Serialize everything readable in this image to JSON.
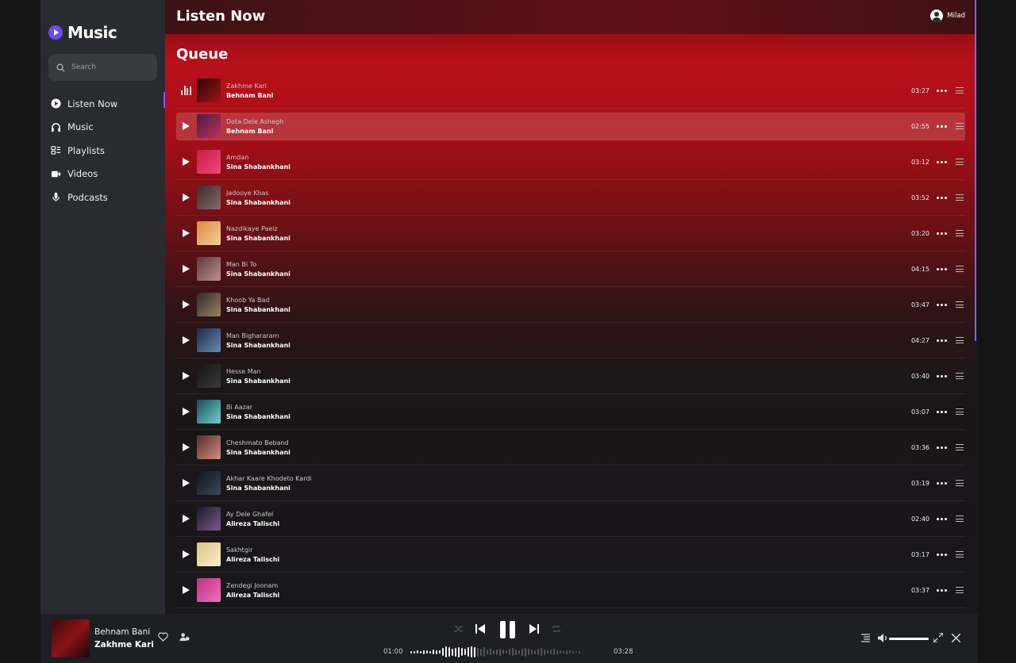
{
  "app": {
    "name": "Music"
  },
  "search": {
    "placeholder": "Search"
  },
  "sidebar": {
    "items": [
      {
        "label": "Listen Now",
        "icon": "play-circle-icon",
        "active": true
      },
      {
        "label": "Music",
        "icon": "headphones-icon",
        "active": false
      },
      {
        "label": "Playlists",
        "icon": "playlist-icon",
        "active": false
      },
      {
        "label": "Videos",
        "icon": "video-icon",
        "active": false
      },
      {
        "label": "Podcasts",
        "icon": "microphone-icon",
        "active": false
      }
    ]
  },
  "header": {
    "title": "Listen Now",
    "user": "Milad"
  },
  "queue": {
    "title": "Queue",
    "tracks": [
      {
        "title": "Zakhme Kari",
        "artist": "Behnam Bani",
        "duration": "03:27",
        "state": "playing",
        "art": [
          "#2a0607",
          "#a11418"
        ]
      },
      {
        "title": "Dota Dele Ashegh",
        "artist": "Behnam Bani",
        "duration": "02:55",
        "state": "hover",
        "art": [
          "#4a1a4a",
          "#c0305a"
        ]
      },
      {
        "title": "Amdan",
        "artist": "Sina Shabankhani",
        "duration": "03:12",
        "state": "",
        "art": [
          "#c81a4a",
          "#f04a78"
        ]
      },
      {
        "title": "Jadooye Khas",
        "artist": "Sina Shabankhani",
        "duration": "03:52",
        "state": "",
        "art": [
          "#3a2a2a",
          "#8a6a6a"
        ]
      },
      {
        "title": "Nazdikaye Paeiz",
        "artist": "Sina Shabankhani",
        "duration": "03:20",
        "state": "",
        "art": [
          "#e08a3a",
          "#f0d0a0"
        ]
      },
      {
        "title": "Man Bi To",
        "artist": "Sina Shabankhani",
        "duration": "04:15",
        "state": "",
        "art": [
          "#5a3a3a",
          "#c09090"
        ]
      },
      {
        "title": "Khoob Ya Bad",
        "artist": "Sina Shabankhani",
        "duration": "03:47",
        "state": "",
        "art": [
          "#2a2a2a",
          "#a08060"
        ]
      },
      {
        "title": "Man Bighararam",
        "artist": "Sina Shabankhani",
        "duration": "04:27",
        "state": "",
        "art": [
          "#1a2a4a",
          "#6a8ab0"
        ]
      },
      {
        "title": "Hesse Man",
        "artist": "Sina Shabankhani",
        "duration": "03:40",
        "state": "",
        "art": [
          "#141414",
          "#3a3a3a"
        ]
      },
      {
        "title": "Bi Aazar",
        "artist": "Sina Shabankhani",
        "duration": "03:07",
        "state": "",
        "art": [
          "#1a4a5a",
          "#70d0d0"
        ]
      },
      {
        "title": "Cheshmato Beband",
        "artist": "Sina Shabankhani",
        "duration": "03:36",
        "state": "",
        "art": [
          "#5a2a2a",
          "#d09080"
        ]
      },
      {
        "title": "Akhar Kaare Khodeto Kardi",
        "artist": "Sina Shabankhani",
        "duration": "03:19",
        "state": "",
        "art": [
          "#101418",
          "#3a4a5a"
        ]
      },
      {
        "title": "Ay Dele Ghafel",
        "artist": "Alireza Talischi",
        "duration": "02:40",
        "state": "",
        "art": [
          "#1a1a2a",
          "#7a5a8a"
        ]
      },
      {
        "title": "Sakhtgir",
        "artist": "Alireza Talischi",
        "duration": "03:17",
        "state": "",
        "art": [
          "#e0c080",
          "#f8f0d0"
        ]
      },
      {
        "title": "Zendegi Joonam",
        "artist": "Alireza Talischi",
        "duration": "03:37",
        "state": "",
        "art": [
          "#c03080",
          "#f070c0"
        ]
      }
    ]
  },
  "player": {
    "artist": "Behnam Bani",
    "title": "Zakhme Kari",
    "elapsed": "01:00",
    "total": "03:28",
    "progress": 0.29
  },
  "colors": {
    "accent": "#8a5cf6",
    "brand": "#6c4cf0"
  }
}
